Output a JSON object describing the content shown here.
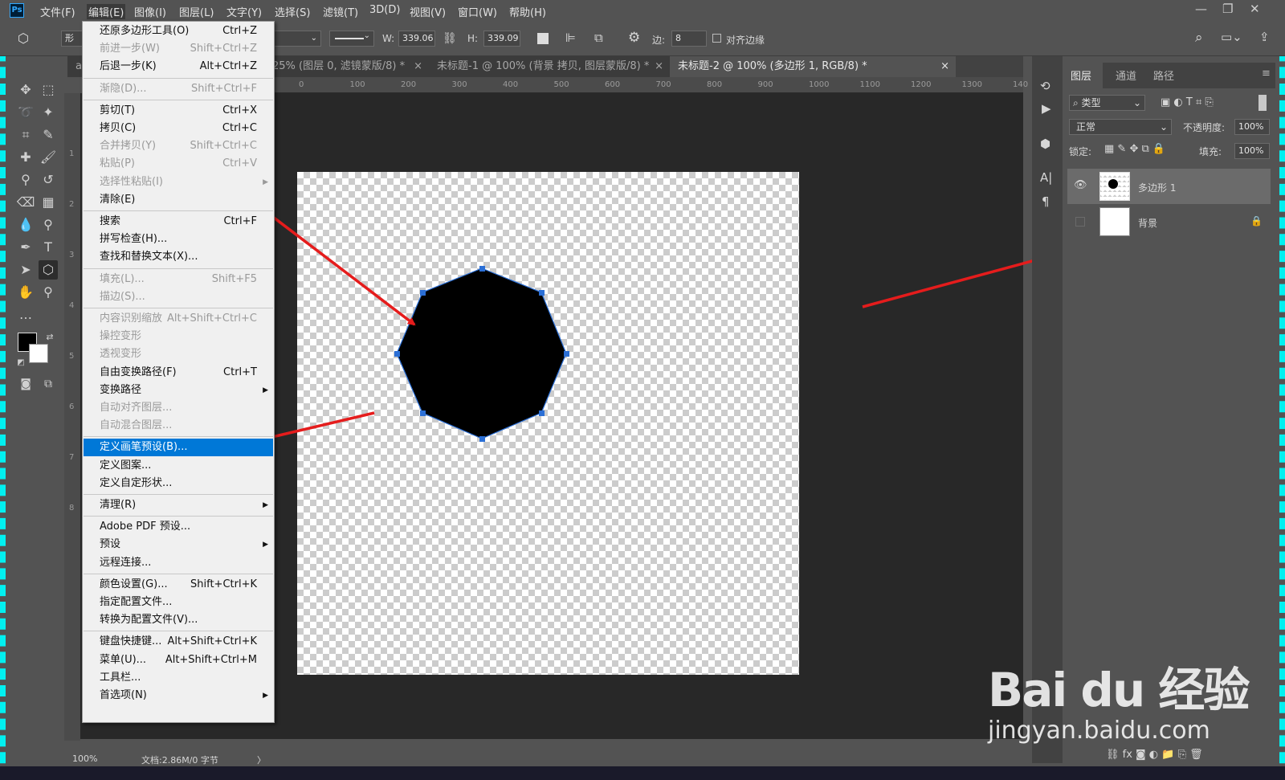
{
  "app": {
    "logo": "Ps"
  },
  "menubar": {
    "items": [
      "文件(F)",
      "编辑(E)",
      "图像(I)",
      "图层(L)",
      "文字(Y)",
      "选择(S)",
      "滤镜(T)",
      "3D(D)",
      "视图(V)",
      "窗口(W)",
      "帮助(H)"
    ],
    "active": "编辑(E)"
  },
  "options": {
    "shape_mode": "形",
    "stroke_type": "",
    "w_label": "W:",
    "w_value": "339.06",
    "h_label": "H:",
    "h_value": "339.09",
    "sides_label": "边:",
    "sides_value": "8",
    "align_edges_label": "对齐边缘"
  },
  "tabs": [
    {
      "label": "25% (图层 0, 滤镜蒙版/8) *",
      "active": false
    },
    {
      "label": "未标题-1 @ 100% (背景 拷贝, 图层蒙版/8) *",
      "active": false
    },
    {
      "label": "未标题-2 @ 100% (多边形 1, RGB/8) *",
      "active": true
    }
  ],
  "ruler_h": [
    "0",
    "100",
    "200",
    "300",
    "400",
    "500",
    "600",
    "700",
    "800",
    "900",
    "1000",
    "1100",
    "1200",
    "1300",
    "140"
  ],
  "ruler_v": [
    "1",
    "2",
    "3",
    "4",
    "5",
    "6",
    "7",
    "8"
  ],
  "menu": {
    "items": [
      {
        "label": "还原多边形工具(O)",
        "shortcut": "Ctrl+Z",
        "disabled": false
      },
      {
        "label": "前进一步(W)",
        "shortcut": "Shift+Ctrl+Z",
        "disabled": true
      },
      {
        "label": "后退一步(K)",
        "shortcut": "Alt+Ctrl+Z",
        "disabled": false
      },
      {
        "label": "渐隐(D)...",
        "shortcut": "Shift+Ctrl+F",
        "disabled": true
      },
      {
        "label": "剪切(T)",
        "shortcut": "Ctrl+X",
        "disabled": false
      },
      {
        "label": "拷贝(C)",
        "shortcut": "Ctrl+C",
        "disabled": false
      },
      {
        "label": "合并拷贝(Y)",
        "shortcut": "Shift+Ctrl+C",
        "disabled": true
      },
      {
        "label": "粘贴(P)",
        "shortcut": "Ctrl+V",
        "disabled": true
      },
      {
        "label": "选择性粘贴(I)",
        "shortcut": "",
        "disabled": true,
        "submenu": true
      },
      {
        "label": "清除(E)",
        "shortcut": "",
        "disabled": false
      },
      {
        "label": "搜索",
        "shortcut": "Ctrl+F",
        "disabled": false
      },
      {
        "label": "拼写检查(H)...",
        "shortcut": "",
        "disabled": false
      },
      {
        "label": "查找和替换文本(X)...",
        "shortcut": "",
        "disabled": false
      },
      {
        "label": "填充(L)...",
        "shortcut": "Shift+F5",
        "disabled": true
      },
      {
        "label": "描边(S)...",
        "shortcut": "",
        "disabled": true
      },
      {
        "label": "内容识别缩放",
        "shortcut": "Alt+Shift+Ctrl+C",
        "disabled": true
      },
      {
        "label": "操控变形",
        "shortcut": "",
        "disabled": true
      },
      {
        "label": "透视变形",
        "shortcut": "",
        "disabled": true
      },
      {
        "label": "自由变换路径(F)",
        "shortcut": "Ctrl+T",
        "disabled": false
      },
      {
        "label": "变换路径",
        "shortcut": "",
        "disabled": false,
        "submenu": true
      },
      {
        "label": "自动对齐图层...",
        "shortcut": "",
        "disabled": true
      },
      {
        "label": "自动混合图层...",
        "shortcut": "",
        "disabled": true
      },
      {
        "label": "定义画笔预设(B)...",
        "shortcut": "",
        "disabled": false,
        "highlighted": true
      },
      {
        "label": "定义图案...",
        "shortcut": "",
        "disabled": false
      },
      {
        "label": "定义自定形状...",
        "shortcut": "",
        "disabled": false
      },
      {
        "label": "清理(R)",
        "shortcut": "",
        "disabled": false,
        "submenu": true
      },
      {
        "label": "Adobe PDF 预设...",
        "shortcut": "",
        "disabled": false
      },
      {
        "label": "预设",
        "shortcut": "",
        "disabled": false,
        "submenu": true
      },
      {
        "label": "远程连接...",
        "shortcut": "",
        "disabled": false
      },
      {
        "label": "颜色设置(G)...",
        "shortcut": "Shift+Ctrl+K",
        "disabled": false
      },
      {
        "label": "指定配置文件...",
        "shortcut": "",
        "disabled": false
      },
      {
        "label": "转换为配置文件(V)...",
        "shortcut": "",
        "disabled": false
      },
      {
        "label": "键盘快捷键...",
        "shortcut": "Alt+Shift+Ctrl+K",
        "disabled": false
      },
      {
        "label": "菜单(U)...",
        "shortcut": "Alt+Shift+Ctrl+M",
        "disabled": false
      },
      {
        "label": "工具栏...",
        "shortcut": "",
        "disabled": false
      },
      {
        "label": "首选项(N)",
        "shortcut": "",
        "disabled": false,
        "submenu": true
      }
    ]
  },
  "layers_panel": {
    "tabs": [
      "图层",
      "通道",
      "路径"
    ],
    "active_tab": "图层",
    "filter_label": "类型",
    "blend_mode": "正常",
    "opacity_label": "不透明度:",
    "opacity_value": "100%",
    "lock_label": "锁定:",
    "fill_label": "填充:",
    "fill_value": "100%",
    "layers": [
      {
        "name": "多边形 1",
        "selected": true,
        "visible": true
      },
      {
        "name": "背景",
        "selected": false,
        "visible": false,
        "locked": true
      }
    ]
  },
  "status": {
    "zoom": "100%",
    "doc_info": "文档:2.86M/0 字节"
  },
  "watermark": {
    "logo": "Bai du 经验",
    "url": "jingyan.baidu.com"
  },
  "colors": {
    "accent": "#0078d7",
    "arrow": "#e51c1c",
    "selection": "#2b6fd6"
  }
}
